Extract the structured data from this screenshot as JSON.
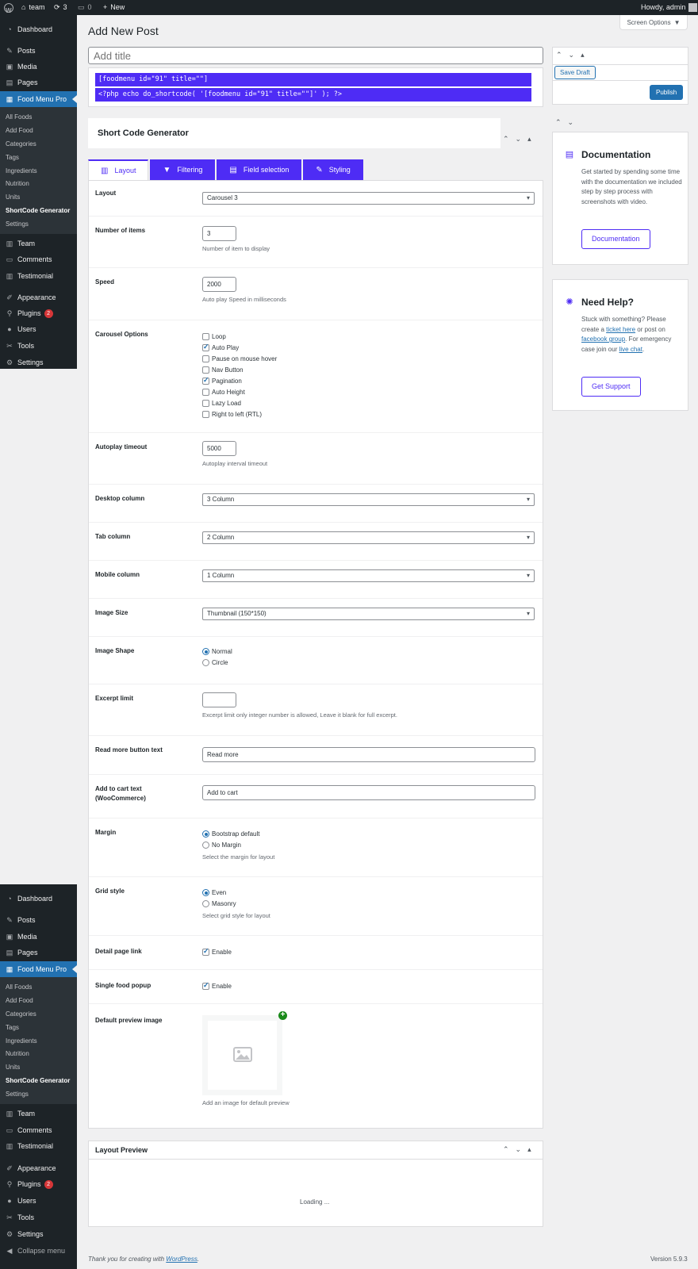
{
  "admin_bar": {
    "site_name": "team",
    "updates": "3",
    "comments": "0",
    "new_label": "New",
    "greeting": "Howdy, admin"
  },
  "menu_top": [
    {
      "label": "Dashboard",
      "icon": "dashboard-icon"
    },
    {
      "label": "Posts",
      "icon": "pin-icon"
    },
    {
      "label": "Media",
      "icon": "media-icon"
    },
    {
      "label": "Pages",
      "icon": "pages-icon"
    },
    {
      "label": "Food Menu Pro",
      "icon": "food-menu-icon"
    }
  ],
  "submenu": [
    "All Foods",
    "Add Food",
    "Categories",
    "Tags",
    "Ingredients",
    "Nutrition",
    "Units",
    "ShortCode Generator",
    "Settings"
  ],
  "menu_bottom": [
    {
      "label": "Team",
      "icon": "team-icon"
    },
    {
      "label": "Comments",
      "icon": "comments-icon"
    },
    {
      "label": "Testimonial",
      "icon": "testimonial-icon"
    },
    {
      "label": "Appearance",
      "icon": "appearance-icon"
    },
    {
      "label": "Plugins",
      "icon": "plugins-icon",
      "badge": "2"
    },
    {
      "label": "Users",
      "icon": "users-icon"
    },
    {
      "label": "Tools",
      "icon": "tools-icon"
    },
    {
      "label": "Settings",
      "icon": "settings-icon"
    }
  ],
  "collapse_label": "Collapse menu",
  "page": {
    "title": "Add New Post",
    "screen_options": "Screen Options",
    "title_placeholder": "Add title"
  },
  "shortcodes": [
    "[foodmenu id=\"91\" title=\"\"]",
    "<?php echo do_shortcode( '[foodmenu id=\"91\" title=\"\"]' ); ?>"
  ],
  "generator": {
    "title": "Short Code Generator"
  },
  "tabs": [
    "Layout",
    "Filtering",
    "Field selection",
    "Styling"
  ],
  "fields": {
    "layout": {
      "label": "Layout",
      "value": "Carousel 3"
    },
    "items": {
      "label": "Number of items",
      "value": "3",
      "help": "Number of item to display"
    },
    "speed": {
      "label": "Speed",
      "value": "2000",
      "help": "Auto play Speed in milliseconds"
    },
    "carousel": {
      "label": "Carousel Options",
      "options": [
        {
          "label": "Loop",
          "checked": false
        },
        {
          "label": "Auto Play",
          "checked": true
        },
        {
          "label": "Pause on mouse hover",
          "checked": false
        },
        {
          "label": "Nav Button",
          "checked": false
        },
        {
          "label": "Pagination",
          "checked": true
        },
        {
          "label": "Auto Height",
          "checked": false
        },
        {
          "label": "Lazy Load",
          "checked": false
        },
        {
          "label": "Right to left (RTL)",
          "checked": false
        }
      ]
    },
    "autoplay_timeout": {
      "label": "Autoplay timeout",
      "value": "5000",
      "help": "Autoplay interval timeout"
    },
    "desktop": {
      "label": "Desktop column",
      "value": "3 Column"
    },
    "tab_col": {
      "label": "Tab column",
      "value": "2 Column"
    },
    "mobile": {
      "label": "Mobile column",
      "value": "1 Column"
    },
    "image_size": {
      "label": "Image Size",
      "value": "Thumbnail (150*150)"
    },
    "image_shape": {
      "label": "Image Shape",
      "options": [
        "Normal",
        "Circle"
      ],
      "selected": "Normal"
    },
    "excerpt": {
      "label": "Excerpt limit",
      "value": "",
      "help": "Excerpt limit only integer number is allowed, Leave it blank for full excerpt."
    },
    "read_more": {
      "label": "Read more button text",
      "value": "Read more"
    },
    "cart": {
      "label": "Add to cart text (WooCommerce)",
      "value": "Add to cart"
    },
    "margin": {
      "label": "Margin",
      "options": [
        "Bootstrap default",
        "No Margin"
      ],
      "selected": "Bootstrap default",
      "help": "Select the margin for layout"
    },
    "grid": {
      "label": "Grid style",
      "options": [
        "Even",
        "Masonry"
      ],
      "selected": "Even",
      "help": "Select grid style for layout"
    },
    "detail_link": {
      "label": "Detail page link",
      "option": "Enable",
      "checked": true
    },
    "popup": {
      "label": "Single food popup",
      "option": "Enable",
      "checked": true
    },
    "preview_image": {
      "label": "Default preview image",
      "help": "Add an image for default preview"
    }
  },
  "preview": {
    "title": "Layout Preview",
    "loading": "Loading ..."
  },
  "publish": {
    "save_draft": "Save Draft",
    "publish": "Publish"
  },
  "documentation": {
    "title": "Documentation",
    "text": "Get started by spending some time with the documentation we included step by step process with screenshots with video.",
    "button": "Documentation"
  },
  "help": {
    "title": "Need Help?",
    "text_1": "Stuck with something? Please create a ",
    "link_1": "ticket here",
    "text_2": " or post on ",
    "link_2": "facebook group",
    "text_3": ". For emergency case join our ",
    "link_3": "live chat",
    "text_4": ".",
    "button": "Get Support"
  },
  "footer": {
    "thanks": "Thank you for creating with ",
    "link": "WordPress",
    "end": ".",
    "version": "Version 5.9.3"
  },
  "colors": {
    "accent": "#4e2cf5",
    "wp_blue": "#2271b1",
    "sidebar": "#1d2327"
  }
}
